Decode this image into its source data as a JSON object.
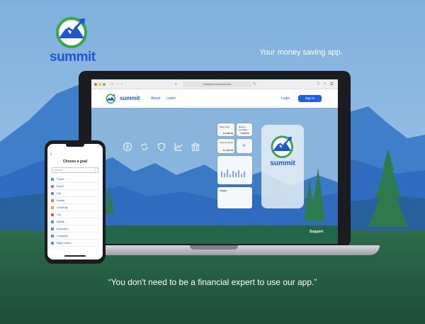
{
  "brand": {
    "name": "summit",
    "tagline": "Your money saving app."
  },
  "quote": "“You don't need to be a financial expert to use our app.”",
  "browser": {
    "url": "ihtmyfunt.summit.com"
  },
  "site": {
    "logo_word": "summit",
    "nav": {
      "about": "About",
      "learn": "Learn",
      "login": "Login",
      "signin": "Sign in"
    },
    "support": "Support"
  },
  "hero_icons": [
    "dollar-circle-icon",
    "refresh-icon",
    "shield-icon",
    "chart-line-icon",
    "bank-icon"
  ],
  "app_cards": {
    "card1": {
      "title": "Rainy Day",
      "amount": "$ 3,000.00"
    },
    "card2": {
      "title": "Beauty purchase",
      "amount": "$ 500.00"
    },
    "card3": {
      "title": "New computer",
      "amount": "$ 1,200.00"
    },
    "insight_title": "Insight"
  },
  "splash_word": "summit",
  "phone": {
    "title": "Choose a goal",
    "search_placeholder": "Search",
    "goals": [
      {
        "label": "Travel",
        "color": "#4a8fe0"
      },
      {
        "label": "Event",
        "color": "#a56be0"
      },
      {
        "label": "Gift",
        "color": "#4a8fe0"
      },
      {
        "label": "House",
        "color": "#e07a3a"
      },
      {
        "label": "Creativity",
        "color": "#e0a43a"
      },
      {
        "label": "Car",
        "color": "#e0553a"
      },
      {
        "label": "Rainte",
        "color": "#4a8fe0"
      },
      {
        "label": "Education",
        "color": "#4a8fe0"
      },
      {
        "label": "Computer",
        "color": "#4a8fe0"
      },
      {
        "label": "Major event",
        "color": "#4a8fe0"
      }
    ]
  },
  "colors": {
    "brand_blue": "#1e56d6",
    "brand_green": "#3aa64a",
    "sky": "#8fb9dd",
    "mountain": "#2f6cc0",
    "grass": "#245f45"
  }
}
